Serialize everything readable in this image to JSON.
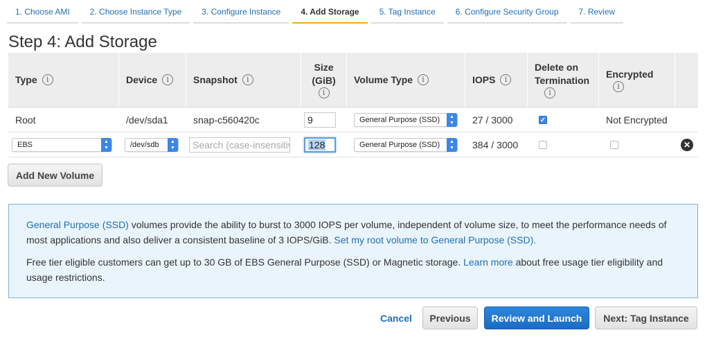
{
  "wizard": {
    "tabs": [
      {
        "label": "1. Choose AMI"
      },
      {
        "label": "2. Choose Instance Type"
      },
      {
        "label": "3. Configure Instance"
      },
      {
        "label": "4. Add Storage"
      },
      {
        "label": "5. Tag Instance"
      },
      {
        "label": "6. Configure Security Group"
      },
      {
        "label": "7. Review"
      }
    ],
    "active_index": 3
  },
  "page": {
    "title": "Step 4: Add Storage"
  },
  "table": {
    "headers": {
      "type": "Type",
      "device": "Device",
      "snapshot": "Snapshot",
      "size_line1": "Size",
      "size_line2": "(GiB)",
      "volume_type": "Volume Type",
      "iops": "IOPS",
      "delete_line1": "Delete on",
      "delete_line2": "Termination",
      "encrypted": "Encrypted",
      "info_glyph": "i"
    },
    "rows": [
      {
        "type": "Root",
        "device": "/dev/sda1",
        "snapshot": "snap-c560420c",
        "size": "9",
        "volume_type": "General Purpose (SSD)",
        "iops": "27 / 3000",
        "delete_on_termination": true,
        "encrypted": "Not Encrypted"
      },
      {
        "type": "EBS",
        "device": "/dev/sdb",
        "snapshot_placeholder": "Search (case-insensitiv",
        "size": "128",
        "volume_type": "General Purpose (SSD)",
        "iops": "384 / 3000",
        "delete_on_termination": false,
        "encrypted": false
      }
    ]
  },
  "buttons": {
    "add_volume": "Add New Volume",
    "cancel": "Cancel",
    "previous": "Previous",
    "review_launch": "Review and Launch",
    "next": "Next: Tag Instance"
  },
  "info": {
    "p1_link": "General Purpose (SSD)",
    "p1_text": " volumes provide the ability to burst to 3000 IOPS per volume, independent of volume size, to meet the performance needs of most applications and also deliver a consistent baseline of 3 IOPS/GiB. ",
    "p1_link2": "Set my root volume to General Purpose (SSD).",
    "p2_text1": "Free tier eligible customers can get up to 30 GB of EBS General Purpose (SSD) or Magnetic storage. ",
    "p2_link": "Learn more",
    "p2_text2": " about free usage tier eligibility and usage restrictions."
  },
  "glyphs": {
    "check": "✓",
    "close": "✕",
    "up": "▲",
    "down": "▼"
  },
  "colors": {
    "accent": "#1f6fb5",
    "active_tab": "#f5a623",
    "primary_button": "#1a6cc4",
    "info_bg": "#eaf4fc"
  }
}
